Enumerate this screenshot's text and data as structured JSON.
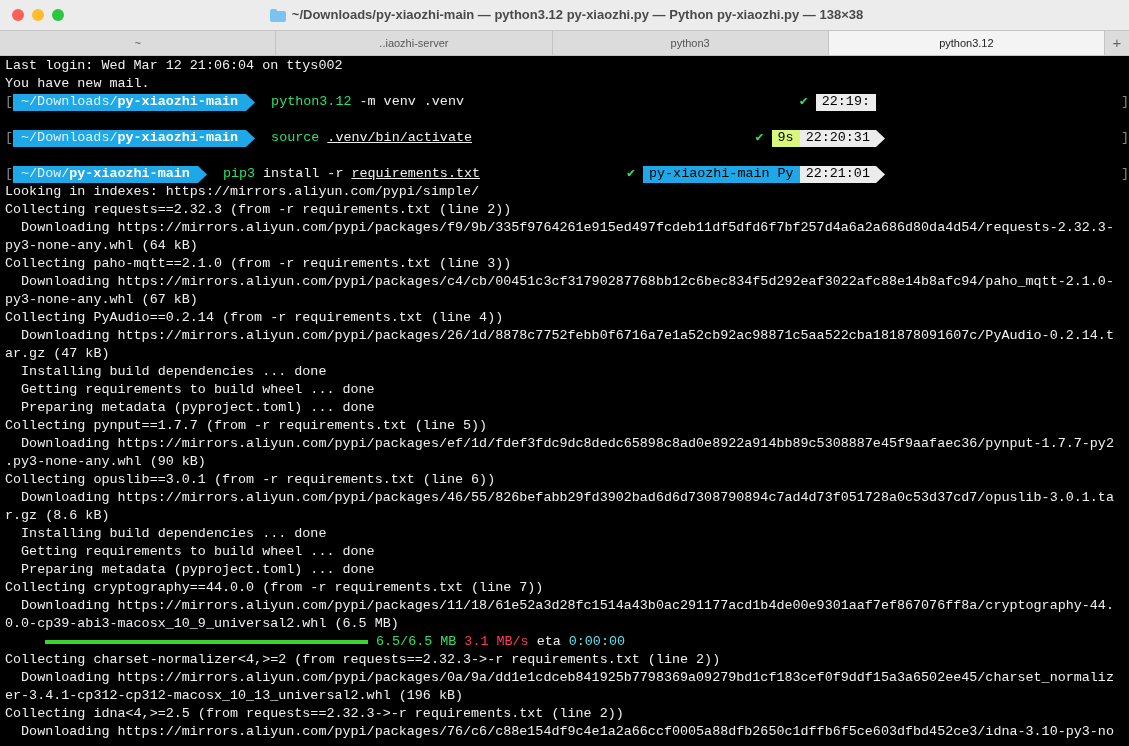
{
  "window": {
    "title": "~/Downloads/py-xiaozhi-main — python3.12 py-xiaozhi.py — Python py-xiaozhi.py — 138×38"
  },
  "tabs": [
    {
      "label": "~",
      "selected": false
    },
    {
      "label": "..iaozhi-server",
      "selected": false
    },
    {
      "label": "python3",
      "selected": false
    },
    {
      "label": "python3.12",
      "selected": true
    }
  ],
  "new_tab": "+",
  "lines": [
    {
      "kind": "plain",
      "text": "Last login: Wed Mar 12 21:06:04 on ttys002"
    },
    {
      "kind": "plain",
      "text": "You have new mail."
    },
    {
      "kind": "prompt",
      "open": "[",
      "close": "]",
      "path_dim": "~/Downloads/",
      "path_bold": "py-xiaozhi-main",
      "command": [
        {
          "text": "python3.12",
          "kind": "program"
        },
        {
          "text": "-m venv .venv",
          "kind": "arg"
        }
      ],
      "status": "✔",
      "segments": [
        {
          "text": "22:19:",
          "kind": "time"
        }
      ],
      "end_arrow": false
    },
    {
      "kind": "blank"
    },
    {
      "kind": "prompt",
      "open": "[",
      "close": "]",
      "path_dim": "~/Downloads/",
      "path_bold": "py-xiaozhi-main",
      "command": [
        {
          "text": "source",
          "kind": "program"
        },
        {
          "text": ".venv/bin/activate",
          "kind": "file"
        }
      ],
      "status": "✔",
      "segments": [
        {
          "text": "9s",
          "kind": "duration"
        },
        {
          "text": "22:20:31",
          "kind": "time"
        }
      ],
      "end_arrow": true
    },
    {
      "kind": "blank"
    },
    {
      "kind": "prompt",
      "open": "[",
      "close": "]",
      "path_dim": "~/Dow/",
      "path_bold": "py-xiaozhi-main",
      "command": [
        {
          "text": "pip3",
          "kind": "program"
        },
        {
          "text": "install -r",
          "kind": "arg"
        },
        {
          "text": "requirements.txt",
          "kind": "file"
        }
      ],
      "status": "✔",
      "segments": [
        {
          "text": "py-xiaozhi-main Py",
          "kind": "venv"
        },
        {
          "text": "22:21:01",
          "kind": "time"
        }
      ],
      "end_arrow": true
    },
    {
      "kind": "plain",
      "text": "Looking in indexes: https://mirrors.aliyun.com/pypi/simple/"
    },
    {
      "kind": "plain",
      "text": "Collecting requests==2.32.3 (from -r requirements.txt (line 2))"
    },
    {
      "kind": "plain",
      "text": "  Downloading https://mirrors.aliyun.com/pypi/packages/f9/9b/335f9764261e915ed497fcdeb11df5dfd6f7bf257d4a6a2a686d80da4d54/requests-2.32.3-"
    },
    {
      "kind": "plain",
      "text": "py3-none-any.whl (64 kB)"
    },
    {
      "kind": "plain",
      "text": "Collecting paho-mqtt==2.1.0 (from -r requirements.txt (line 3))"
    },
    {
      "kind": "plain",
      "text": "  Downloading https://mirrors.aliyun.com/pypi/packages/c4/cb/00451c3cf31790287768bb12c6bec834f5d292eaf3022afc88e14b8afc94/paho_mqtt-2.1.0-"
    },
    {
      "kind": "plain",
      "text": "py3-none-any.whl (67 kB)"
    },
    {
      "kind": "plain",
      "text": "Collecting PyAudio==0.2.14 (from -r requirements.txt (line 4))"
    },
    {
      "kind": "plain",
      "text": "  Downloading https://mirrors.aliyun.com/pypi/packages/26/1d/8878c7752febb0f6716a7e1a52cb92ac98871c5aa522cba181878091607c/PyAudio-0.2.14.t"
    },
    {
      "kind": "plain",
      "text": "ar.gz (47 kB)"
    },
    {
      "kind": "plain",
      "text": "  Installing build dependencies ... done"
    },
    {
      "kind": "plain",
      "text": "  Getting requirements to build wheel ... done"
    },
    {
      "kind": "plain",
      "text": "  Preparing metadata (pyproject.toml) ... done"
    },
    {
      "kind": "plain",
      "text": "Collecting pynput==1.7.7 (from -r requirements.txt (line 5))"
    },
    {
      "kind": "plain",
      "text": "  Downloading https://mirrors.aliyun.com/pypi/packages/ef/1d/fdef3fdc9dc8dedc65898c8ad0e8922a914bb89c5308887e45f9aafaec36/pynput-1.7.7-py2"
    },
    {
      "kind": "plain",
      "text": ".py3-none-any.whl (90 kB)"
    },
    {
      "kind": "plain",
      "text": "Collecting opuslib==3.0.1 (from -r requirements.txt (line 6))"
    },
    {
      "kind": "plain",
      "text": "  Downloading https://mirrors.aliyun.com/pypi/packages/46/55/826befabb29fd3902bad6d6d7308790894c7ad4d73f051728a0c53d37cd7/opuslib-3.0.1.ta"
    },
    {
      "kind": "plain",
      "text": "r.gz (8.6 kB)"
    },
    {
      "kind": "plain",
      "text": "  Installing build dependencies ... done"
    },
    {
      "kind": "plain",
      "text": "  Getting requirements to build wheel ... done"
    },
    {
      "kind": "plain",
      "text": "  Preparing metadata (pyproject.toml) ... done"
    },
    {
      "kind": "plain",
      "text": "Collecting cryptography==44.0.0 (from -r requirements.txt (line 7))"
    },
    {
      "kind": "plain",
      "text": "  Downloading https://mirrors.aliyun.com/pypi/packages/11/18/61e52a3d28fc1514a43b0ac291177acd1b4de00e9301aaf7ef867076ff8a/cryptography-44."
    },
    {
      "kind": "plain",
      "text": "0.0-cp39-abi3-macosx_10_9_universal2.whl (6.5 MB)"
    },
    {
      "kind": "progress",
      "level": 1,
      "size": "6.5/6.5 MB",
      "speed": "3.1 MB/s",
      "eta_label": "eta",
      "eta": "0:00:00"
    },
    {
      "kind": "plain",
      "text": "Collecting charset-normalizer<4,>=2 (from requests==2.32.3->-r requirements.txt (line 2))"
    },
    {
      "kind": "plain",
      "text": "  Downloading https://mirrors.aliyun.com/pypi/packages/0a/9a/dd1e1cdceb841925b7798369a09279bd1cf183cef0f9ddf15a3a6502ee45/charset_normaliz"
    },
    {
      "kind": "plain",
      "text": "er-3.4.1-cp312-cp312-macosx_10_13_universal2.whl (196 kB)"
    },
    {
      "kind": "plain",
      "text": "Collecting idna<4,>=2.5 (from requests==2.32.3->-r requirements.txt (line 2))"
    },
    {
      "kind": "plain",
      "text": "  Downloading https://mirrors.aliyun.com/pypi/packages/76/c6/c88e154df9c4e1a2a66ccf0005a88dfb2650c1dffb6f5ce603dfbd452ce3/idna-3.10-py3-no"
    }
  ]
}
